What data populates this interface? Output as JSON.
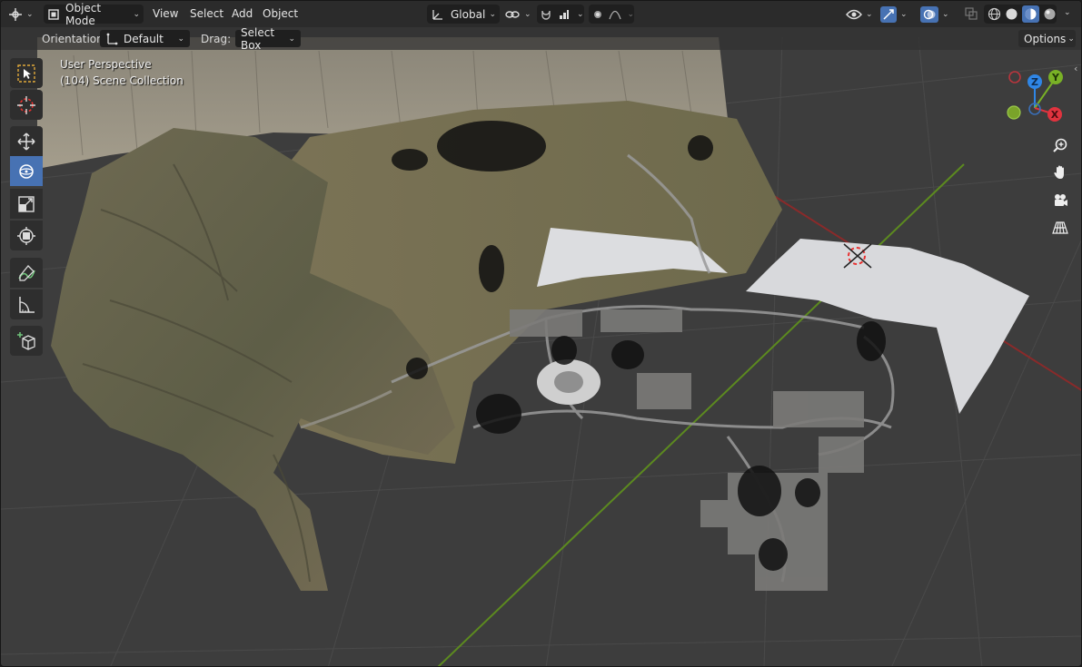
{
  "header": {
    "mode_label": "Object Mode",
    "menus": [
      "View",
      "Select",
      "Add",
      "Object"
    ],
    "transform_orientation": "Global",
    "options_label": "Options"
  },
  "tool_settings": {
    "orientation_label": "Orientation:",
    "orientation_value": "Default",
    "drag_label": "Drag:",
    "drag_value": "Select Box"
  },
  "viewport": {
    "perspective_label": "User Perspective",
    "collection_label": "(104) Scene Collection"
  },
  "gizmo": {
    "x_label": "X",
    "y_label": "Y",
    "z_label": "Z",
    "colors": {
      "x": "#e0333e",
      "y": "#79b126",
      "z": "#2f86e6"
    }
  },
  "tools": [
    "select-box-icon",
    "cursor-icon",
    "move-icon",
    "rotate-icon",
    "scale-icon",
    "transform-icon",
    "annotate-icon",
    "measure-icon",
    "add-cube-icon"
  ],
  "colors": {
    "accent": "#4772b3",
    "header": "#2b2b2b",
    "viewport_bg": "#3d3d3d"
  }
}
